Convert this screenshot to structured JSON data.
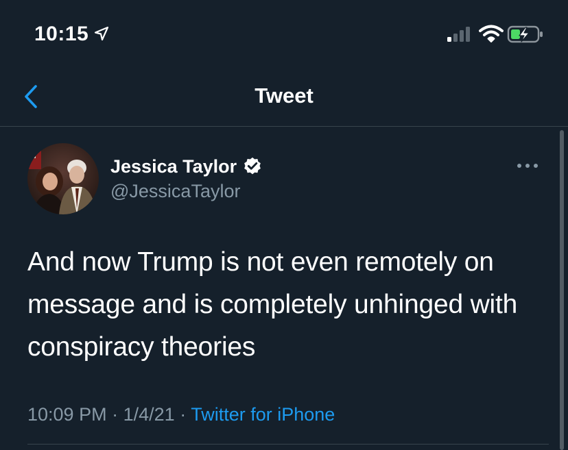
{
  "status_bar": {
    "time": "10:15",
    "icons": [
      "location-arrow-icon",
      "cellular-signal-icon",
      "wifi-icon",
      "battery-charging-icon"
    ],
    "battery_color": "#4cd964"
  },
  "nav": {
    "title": "Tweet",
    "back_icon": "chevron-left-icon",
    "accent_color": "#1d9bf0"
  },
  "tweet": {
    "author_name": "Jessica Taylor",
    "author_handle": "@JessicaTaylor",
    "verified": true,
    "text": "And now Trump is not even remotely on message and is completely unhinged with conspiracy theories",
    "time": "10:09 PM",
    "separator": "·",
    "date": "1/4/21",
    "source": "Twitter for iPhone",
    "more_icon": "more-horizontal-icon"
  },
  "colors": {
    "background": "#15202b",
    "text": "#ffffff",
    "secondary_text": "#8899a6",
    "divider": "#38444d",
    "link": "#1d9bf0"
  }
}
